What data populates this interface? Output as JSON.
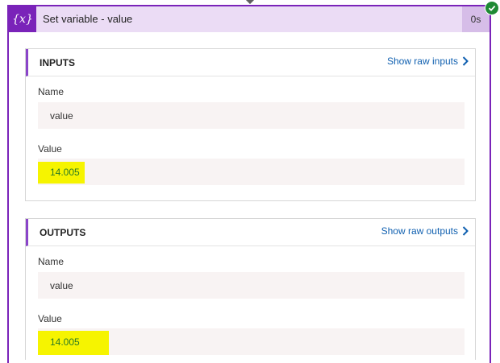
{
  "action": {
    "icon": "variable-icon",
    "icon_glyph": "{x}",
    "title": "Set variable - value",
    "duration": "0s",
    "status": "succeeded",
    "accent_color": "#7a23b9",
    "success_color": "#1f8a34"
  },
  "inputs": {
    "heading": "INPUTS",
    "raw_link": "Show raw inputs",
    "fields": [
      {
        "label": "Name",
        "value": "value"
      },
      {
        "label": "Value",
        "value": "14.005"
      }
    ]
  },
  "outputs": {
    "heading": "OUTPUTS",
    "raw_link": "Show raw outputs",
    "fields": [
      {
        "label": "Name",
        "value": "value"
      },
      {
        "label": "Value",
        "value": "14.005"
      }
    ]
  }
}
